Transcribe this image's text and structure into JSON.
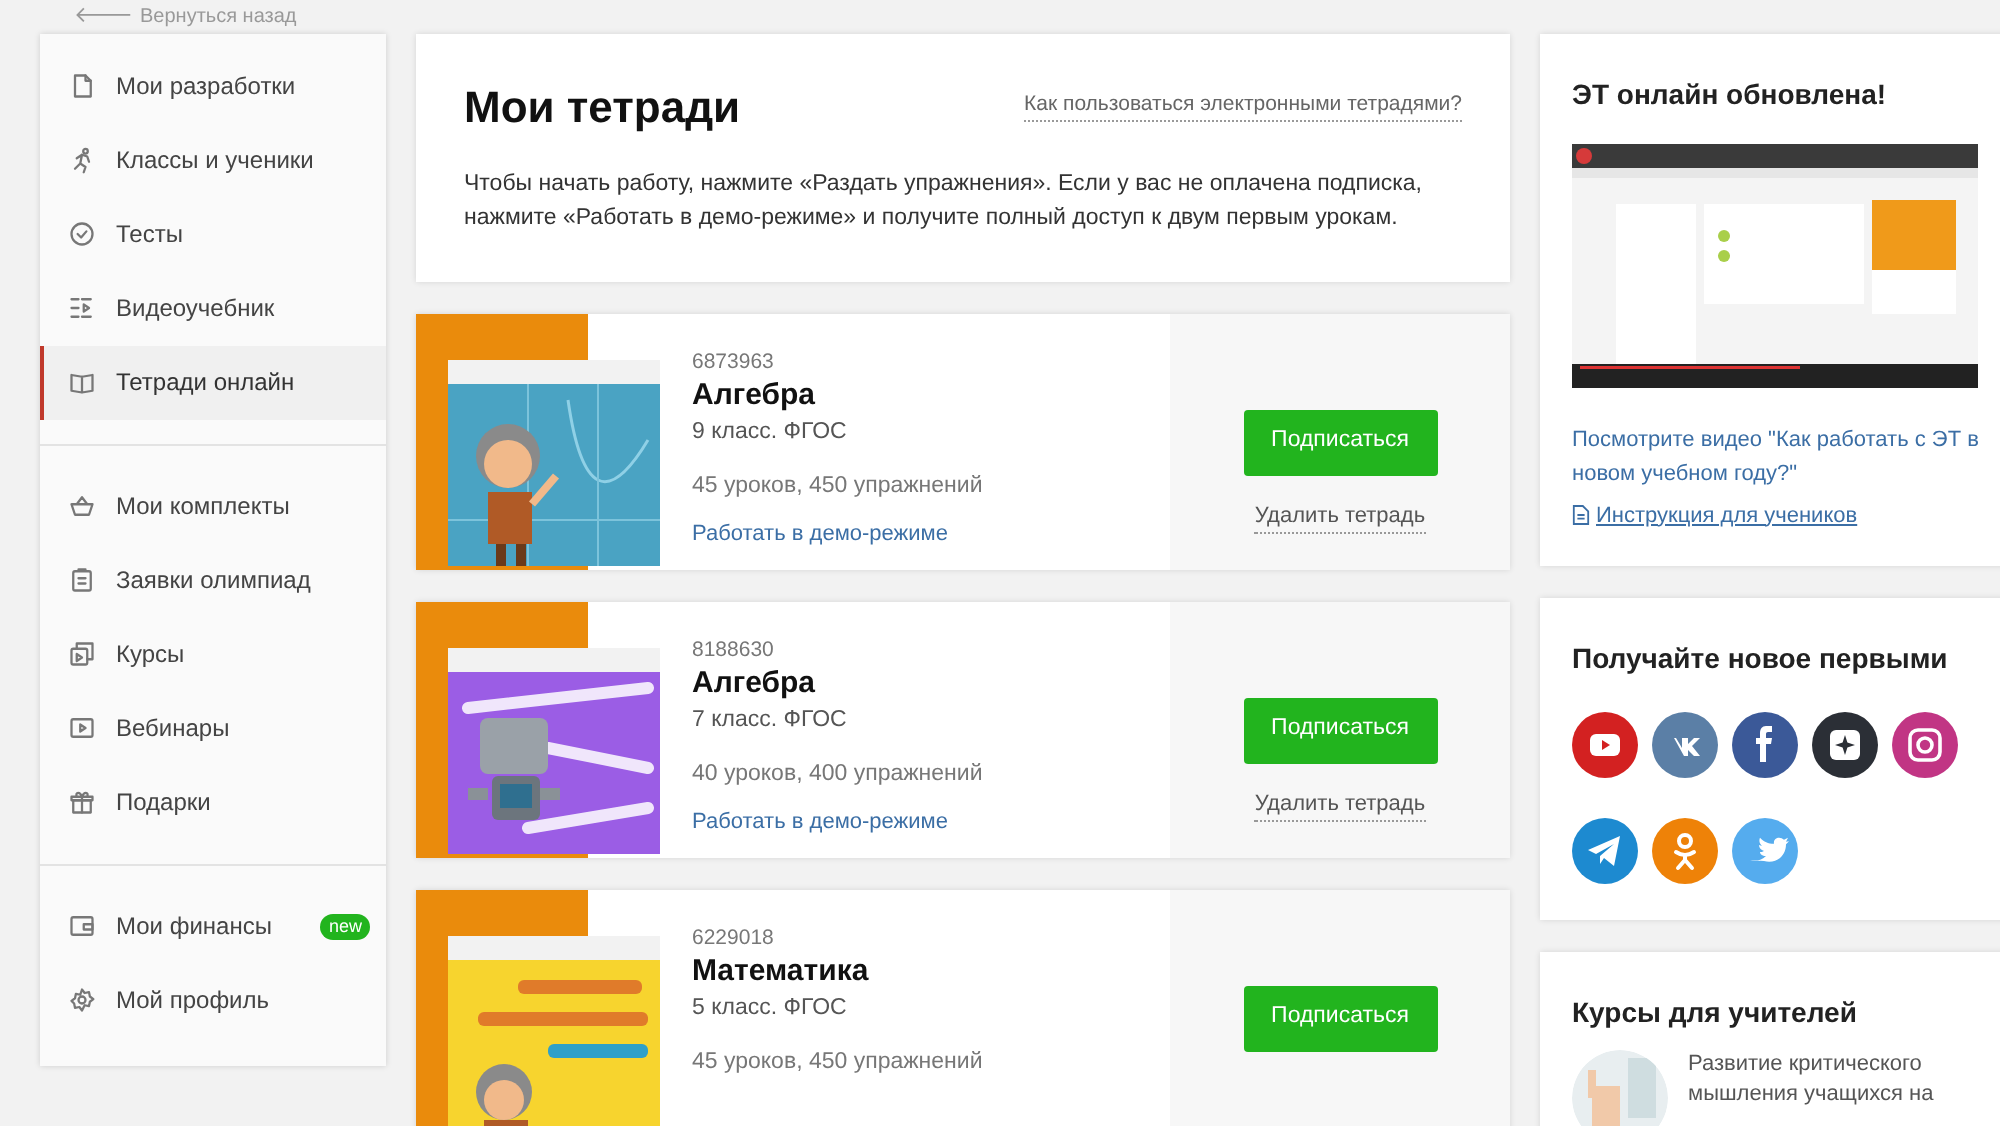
{
  "back_link": {
    "arrow": "🡐",
    "label": "Вернуться назад"
  },
  "sidebar": {
    "groups": [
      [
        {
          "label": "Мои разработки",
          "selected": false
        },
        {
          "label": "Классы и ученики",
          "selected": false
        },
        {
          "label": "Тесты",
          "selected": false
        },
        {
          "label": "Видеоучебник",
          "selected": false
        },
        {
          "label": "Тетради онлайн",
          "selected": true
        }
      ],
      [
        {
          "label": "Мои комплекты",
          "selected": false
        },
        {
          "label": "Заявки олимпиад",
          "selected": false
        },
        {
          "label": "Курсы",
          "selected": false
        },
        {
          "label": "Вебинары",
          "selected": false
        },
        {
          "label": "Подарки",
          "selected": false
        }
      ],
      [
        {
          "label": "Мои финансы",
          "selected": false,
          "badge": "new"
        },
        {
          "label": "Мой профиль",
          "selected": false
        }
      ]
    ]
  },
  "header": {
    "title": "Мои тетради",
    "help_link": "Как пользоваться электронными тетрадями?",
    "description": "Чтобы начать работу, нажмите «Раздать упражнения». Если у вас не оплачена подписка, нажмите «Работать в демо-режиме» и получите полный доступ к двум первым урокам."
  },
  "notebooks": [
    {
      "id": "6873963",
      "title": "Алгебра",
      "grade": "9 класс. ФГОС",
      "stats": "45 уроков, 450 упражнений",
      "demo_link": "Работать в демо-режиме",
      "subscribe_button": "Подписаться",
      "delete_link": "Удалить тетрадь"
    },
    {
      "id": "8188630",
      "title": "Алгебра",
      "grade": "7 класс. ФГОС",
      "stats": "40 уроков, 400 упражнений",
      "demo_link": "Работать в демо-режиме",
      "subscribe_button": "Подписаться",
      "delete_link": "Удалить тетрадь"
    },
    {
      "id": "6229018",
      "title": "Математика",
      "grade": "5 класс. ФГОС",
      "stats": "45 уроков, 450 упражнений",
      "subscribe_button": "Подписаться"
    }
  ],
  "update_card": {
    "title": "ЭТ онлайн обновлена!",
    "video_link": "Посмотрите видео \"Как работать с ЭТ в новом учебном году?\"",
    "instructions_link": "Инструкция для учеников"
  },
  "social_card": {
    "title": "Получайте новое первыми",
    "networks": [
      {
        "color": "#d32121"
      },
      {
        "color": "#5b7fa6"
      },
      {
        "color": "#3b5998"
      },
      {
        "color": "#2b2f36"
      },
      {
        "color": "#c13584"
      },
      {
        "color": "#1d8ad0"
      },
      {
        "color": "#ee8208"
      },
      {
        "color": "#55acee"
      }
    ]
  },
  "courses_card": {
    "title": "Курсы для учителей",
    "course": "Развитие критического мышления учащихся на"
  }
}
